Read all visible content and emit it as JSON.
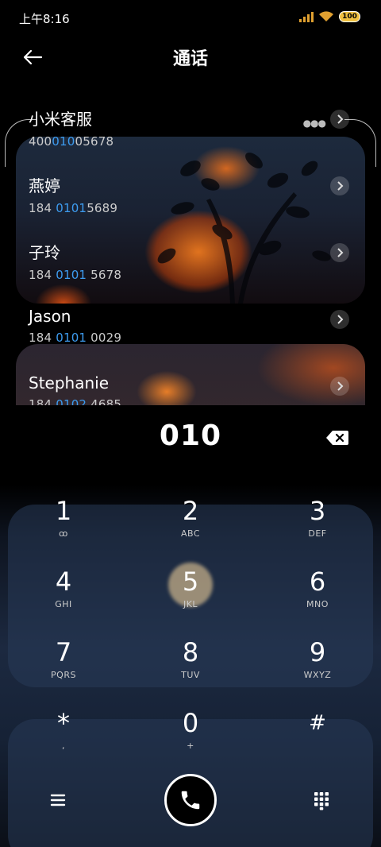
{
  "status": {
    "time": "上午8:16",
    "battery": "100"
  },
  "header": {
    "title": "通话"
  },
  "contacts": [
    {
      "name": "小米客服",
      "num_pre": "400",
      "num_hl": "010",
      "num_post": "05678"
    },
    {
      "name": "燕婷",
      "num_pre": "184 ",
      "num_hl": "0101",
      "num_post": "5689"
    },
    {
      "name": "子玲",
      "num_pre": "184 ",
      "num_hl": "0101",
      "num_post": " 5678"
    },
    {
      "name": "Jason",
      "num_pre": "184 ",
      "num_hl": "0101",
      "num_post": " 0029"
    },
    {
      "name": "Stephanie",
      "num_pre": "184 ",
      "num_hl": "0102",
      "num_post": " 4685"
    }
  ],
  "dial": {
    "input": "010",
    "keys": [
      {
        "digit": "1",
        "letters": "ꝏ"
      },
      {
        "digit": "2",
        "letters": "ABC"
      },
      {
        "digit": "3",
        "letters": "DEF"
      },
      {
        "digit": "4",
        "letters": "GHI"
      },
      {
        "digit": "5",
        "letters": "JKL"
      },
      {
        "digit": "6",
        "letters": "MNO"
      },
      {
        "digit": "7",
        "letters": "PQRS"
      },
      {
        "digit": "8",
        "letters": "TUV"
      },
      {
        "digit": "9",
        "letters": "WXYZ"
      },
      {
        "digit": "*",
        "letters": ","
      },
      {
        "digit": "0",
        "letters": "+"
      },
      {
        "digit": "#",
        "letters": ""
      }
    ]
  },
  "icons": {
    "back": "arrow-left-icon",
    "backspace": "backspace-icon",
    "menu": "menu-icon",
    "call": "phone-icon",
    "keypad": "dialpad-icon"
  }
}
